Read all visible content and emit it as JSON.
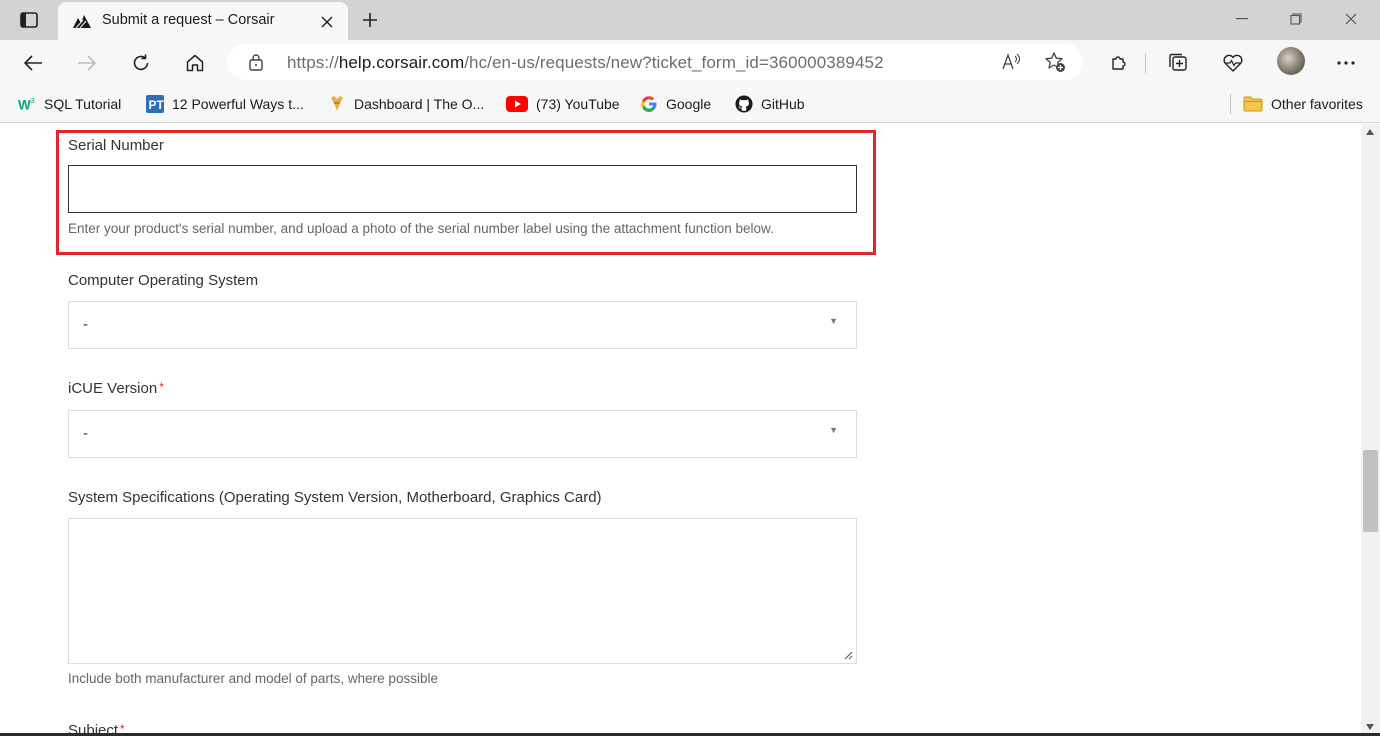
{
  "tab": {
    "title": "Submit a request – Corsair"
  },
  "address": {
    "url_prefix": "https://",
    "url_host": "help.corsair.com",
    "url_path": "/hc/en-us/requests/new?ticket_form_id=360000389452"
  },
  "favorites": [
    {
      "label": "SQL Tutorial",
      "icon": "w3schools-icon"
    },
    {
      "label": "12 Powerful Ways t...",
      "icon": "pt-icon"
    },
    {
      "label": "Dashboard | The O...",
      "icon": "odin-icon"
    },
    {
      "label": "(73) YouTube",
      "icon": "youtube-icon"
    },
    {
      "label": "Google",
      "icon": "google-icon"
    },
    {
      "label": "GitHub",
      "icon": "github-icon"
    }
  ],
  "other_favorites": "Other favorites",
  "form": {
    "serial": {
      "label": "Serial Number",
      "value": "",
      "hint": "Enter your product's serial number, and upload a photo of the serial number label using the attachment function below."
    },
    "os": {
      "label": "Computer Operating System",
      "value": "-"
    },
    "icue": {
      "label": "iCUE Version",
      "required_mark": "*",
      "value": "-"
    },
    "specs": {
      "label": "System Specifications (Operating System Version, Motherboard, Graphics Card)",
      "value": "",
      "hint": "Include both manufacturer and model of parts, where possible"
    },
    "subject": {
      "label": "Subject",
      "required_mark": "*"
    }
  },
  "colors": {
    "highlight": "#e0262c",
    "required": "#e0262c"
  }
}
